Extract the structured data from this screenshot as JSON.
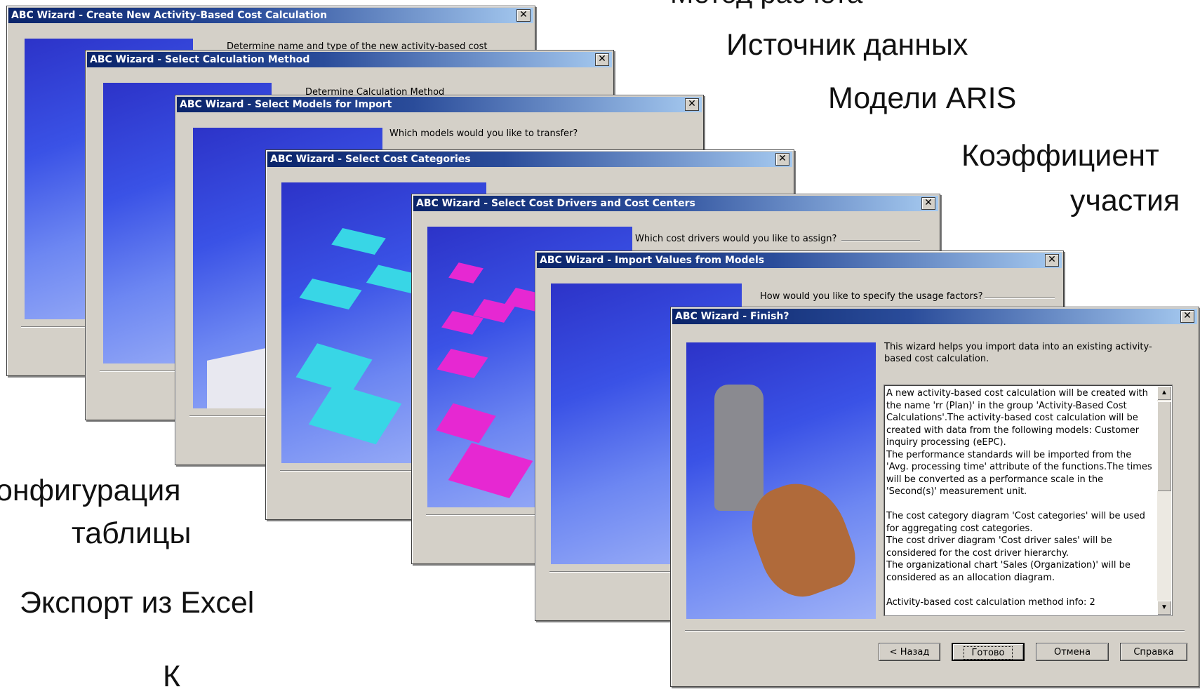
{
  "labels": {
    "top_cut": "Метод расчета",
    "data_source": "Источник данных",
    "aris_models": "Модели ARIS",
    "coeff_line1": "Коэффициент",
    "coeff_line2": "участия",
    "config_line1": "онфигурация",
    "config_line2": "таблицы",
    "excel_export": "Экспорт из Excel",
    "bottom_cut": "К"
  },
  "windows": [
    {
      "title": "ABC Wizard - Create New Activity-Based Cost Calculation",
      "text": "Determine name and type of the new activity-based cost"
    },
    {
      "title": "ABC Wizard - Select Calculation Method",
      "text": "Determine Calculation Method"
    },
    {
      "title": "ABC Wizard - Select Models for Import",
      "text": "Which models would you like to transfer?"
    },
    {
      "title": "ABC Wizard - Select Cost Categories",
      "text": ""
    },
    {
      "title": "ABC Wizard - Select Cost Drivers and Cost Centers",
      "text": "Which cost drivers would you like to assign?"
    },
    {
      "title": "ABC Wizard - Import Values from Models",
      "text": "How would you like to specify the usage factors?"
    },
    {
      "title": "ABC Wizard - Finish?",
      "text": "This wizard helps you import data into an existing activity-based cost calculation."
    }
  ],
  "close_glyph": "✕",
  "finish": {
    "summary": [
      "A new activity-based cost calculation will be created with the name 'rr (Plan)' in the group 'Activity-Based Cost Calculations'.The activity-based cost calculation will be created with data from the following models: Customer inquiry processing (eEPC).",
      "The performance standards will be imported from the 'Avg. processing time' attribute of the functions.The times will be converted as a performance scale in the 'Second(s)' measurement unit.",
      "",
      "The cost category diagram 'Cost categories' will be used for aggregating cost categories.",
      "The cost driver diagram 'Cost driver sales' will be considered for the cost driver hierarchy.",
      "The organizational chart 'Sales (Organization)' will be considered as an allocation diagram.",
      "",
      "Activity-based cost calculation method info: 2"
    ],
    "buttons": {
      "back": "< Назад",
      "finish": "Готово",
      "cancel": "Отмена",
      "help": "Справка"
    }
  },
  "colors": {
    "titlebar_start": "#0a246a",
    "titlebar_end": "#a6caf0",
    "dialog_bg": "#d4d0c8",
    "art_blue": "#3a52e6",
    "cyan_blocks": "#38d6e6",
    "magenta_blocks": "#e628d2"
  }
}
